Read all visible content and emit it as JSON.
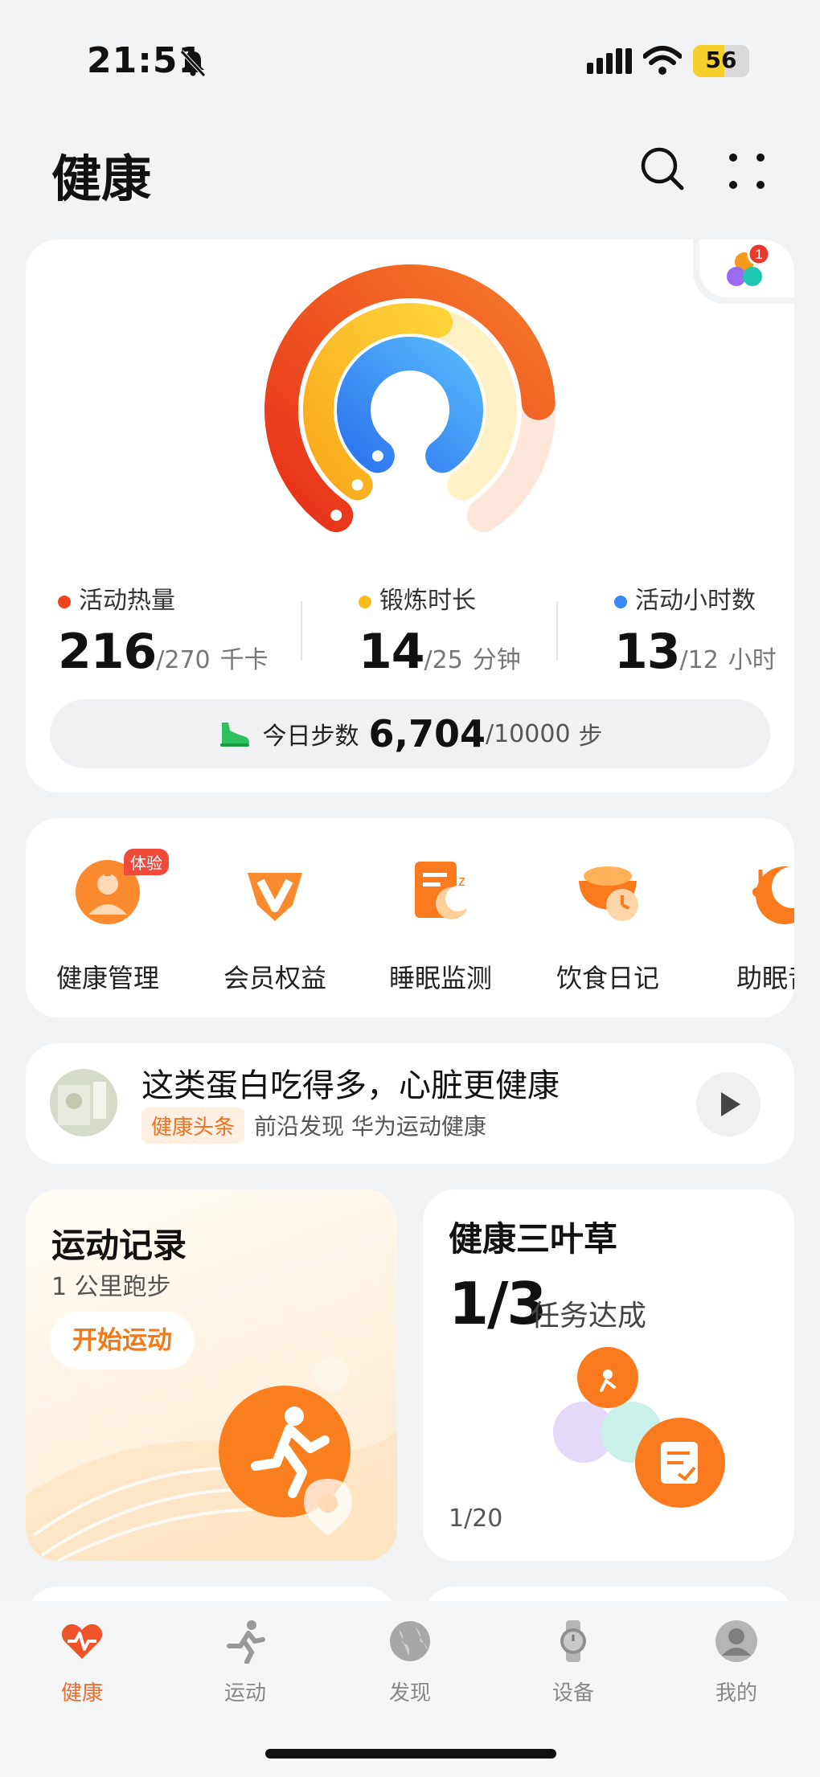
{
  "status_bar": {
    "time": "21:51",
    "battery": "56",
    "battery_level": 0.56,
    "icons": [
      "bell-muted-icon",
      "signal-icon",
      "wifi-icon",
      "battery-icon"
    ]
  },
  "header": {
    "title": "健康",
    "icons": [
      "search-icon",
      "more-grid-icon"
    ]
  },
  "activity": {
    "badge_count": "1",
    "rings": [
      {
        "name": "活动热量",
        "value": 216,
        "goal": 270,
        "color": "#f0441e"
      },
      {
        "name": "锻炼时长",
        "value": 14,
        "goal": 25,
        "color": "#fbbd1a"
      },
      {
        "name": "活动小时数",
        "value": 13,
        "goal": 12,
        "color": "#3a88f5"
      }
    ],
    "metrics": [
      {
        "label": "活动热量",
        "value": "216",
        "goal": "/270",
        "unit": "千卡",
        "color": "#f0441e"
      },
      {
        "label": "锻炼时长",
        "value": "14",
        "goal": "/25",
        "unit": "分钟",
        "color": "#fbbd1a"
      },
      {
        "label": "活动小时数",
        "value": "13",
        "goal": "/12",
        "unit": "小时",
        "color": "#3a88f5"
      }
    ],
    "steps": {
      "label": "今日步数",
      "value": "6,704",
      "goal": "/10000",
      "unit": "步"
    }
  },
  "shortcuts": [
    {
      "label": "健康管理",
      "badge": "体验",
      "icon": "health-management-icon"
    },
    {
      "label": "会员权益",
      "icon": "membership-v-icon"
    },
    {
      "label": "睡眠监测",
      "icon": "sleep-monitor-icon"
    },
    {
      "label": "饮食日记",
      "icon": "diet-diary-icon"
    },
    {
      "label": "助眠音",
      "icon": "sleep-music-icon"
    }
  ],
  "news": {
    "title": "这类蛋白吃得多，心脏更健康",
    "tag": "健康头条",
    "source": "前沿发现 华为运动健康"
  },
  "sport_card": {
    "title": "运动记录",
    "subtitle": "1 公里跑步",
    "button": "开始运动"
  },
  "clover_card": {
    "title": "健康三叶草",
    "value": "1/3",
    "unit": "任务达成",
    "footer": "1/20"
  },
  "tabs": [
    {
      "label": "健康",
      "icon": "heart-pulse-icon",
      "active": true
    },
    {
      "label": "运动",
      "icon": "running-icon",
      "active": false
    },
    {
      "label": "发现",
      "icon": "globe-icon",
      "active": false
    },
    {
      "label": "设备",
      "icon": "watch-icon",
      "active": false
    },
    {
      "label": "我的",
      "icon": "profile-icon",
      "active": false
    }
  ]
}
